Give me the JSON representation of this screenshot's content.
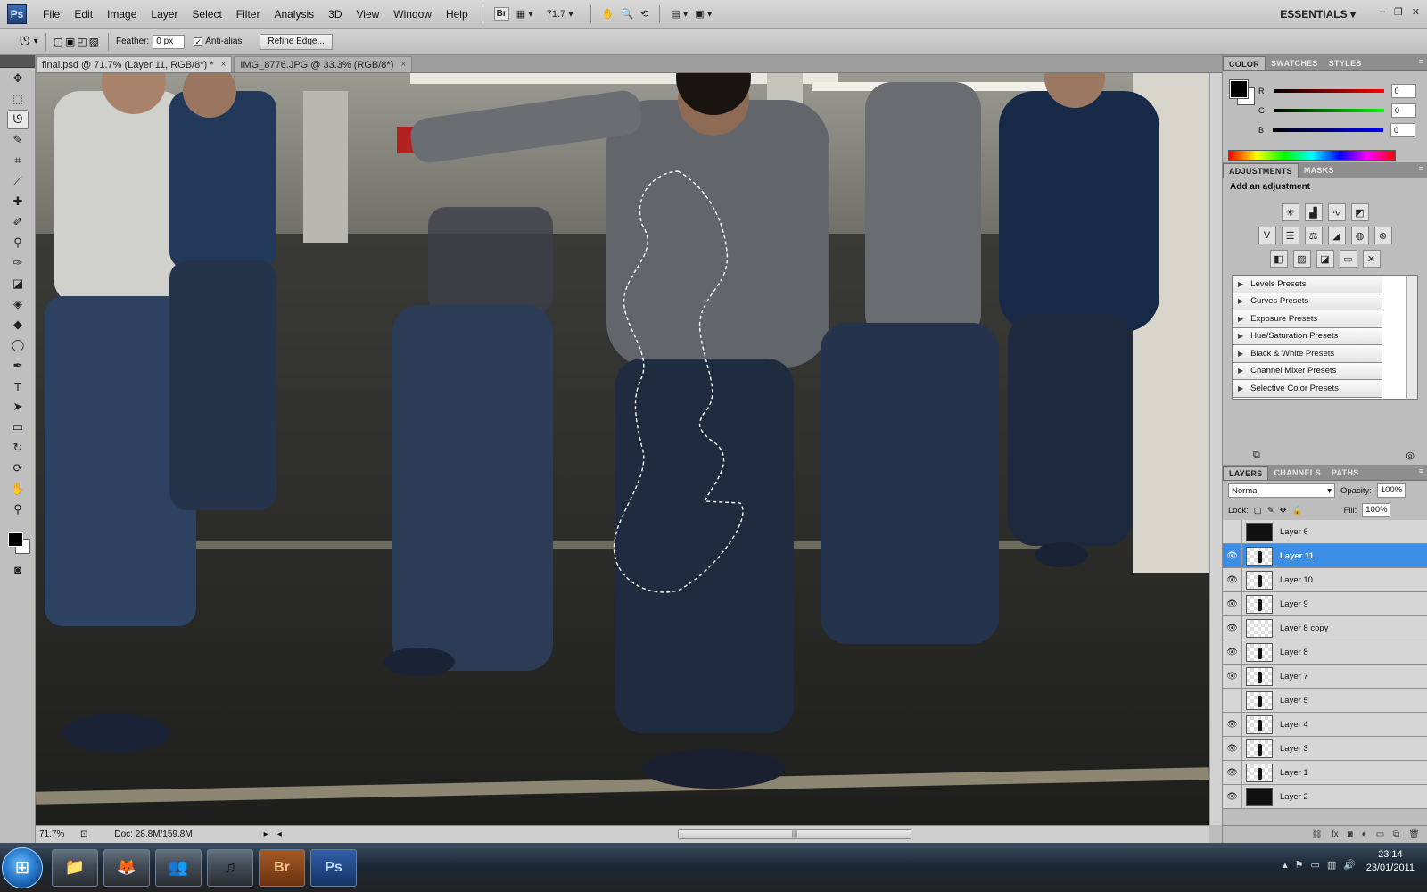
{
  "menubar": {
    "logo": "Ps",
    "items": [
      "File",
      "Edit",
      "Image",
      "Layer",
      "Select",
      "Filter",
      "Analysis",
      "3D",
      "View",
      "Window",
      "Help"
    ],
    "bridge_btn": "Br",
    "zoom": "71.7",
    "workspace": "ESSENTIALS"
  },
  "options": {
    "feather_label": "Feather:",
    "feather_value": "0 px",
    "antialias_label": "Anti-alias",
    "antialias_checked": "✓",
    "refine_edge": "Refine Edge..."
  },
  "tabs": [
    {
      "label": "final.psd @ 71.7% (Layer 11, RGB/8*) *",
      "close": "×"
    },
    {
      "label": "IMG_8776.JPG @ 33.3% (RGB/8*)",
      "close": "×"
    }
  ],
  "status": {
    "zoom": "71.7%",
    "doc": "Doc: 28.8M/159.8M"
  },
  "color_panel": {
    "tabs": [
      "COLOR",
      "SWATCHES",
      "STYLES"
    ],
    "channels": [
      {
        "label": "R",
        "value": "0",
        "color": "#d60000"
      },
      {
        "label": "G",
        "value": "0",
        "color": "#00b000"
      },
      {
        "label": "B",
        "value": "0",
        "color": "#0030d0"
      }
    ]
  },
  "adjustments": {
    "tabs": [
      "ADJUSTMENTS",
      "MASKS"
    ],
    "title": "Add an adjustment",
    "presets": [
      "Levels Presets",
      "Curves Presets",
      "Exposure Presets",
      "Hue/Saturation Presets",
      "Black & White Presets",
      "Channel Mixer Presets",
      "Selective Color Presets"
    ]
  },
  "layers_panel": {
    "tabs": [
      "LAYERS",
      "CHANNELS",
      "PATHS"
    ],
    "blend_mode": "Normal",
    "opacity_label": "Opacity:",
    "opacity": "100%",
    "lock_label": "Lock:",
    "fill_label": "Fill:",
    "fill": "100%",
    "layers": [
      {
        "name": "Layer 6",
        "visible": "",
        "selected": false
      },
      {
        "name": "Layer 11",
        "visible": "👁",
        "selected": true
      },
      {
        "name": "Layer 10",
        "visible": "👁",
        "selected": false
      },
      {
        "name": "Layer 9",
        "visible": "👁",
        "selected": false
      },
      {
        "name": "Layer 8 copy",
        "visible": "👁",
        "selected": false
      },
      {
        "name": "Layer 8",
        "visible": "👁",
        "selected": false
      },
      {
        "name": "Layer 7",
        "visible": "👁",
        "selected": false
      },
      {
        "name": "Layer 5",
        "visible": "",
        "selected": false
      },
      {
        "name": "Layer 4",
        "visible": "👁",
        "selected": false
      },
      {
        "name": "Layer 3",
        "visible": "👁",
        "selected": false
      },
      {
        "name": "Layer 1",
        "visible": "👁",
        "selected": false
      },
      {
        "name": "Layer 2",
        "visible": "👁",
        "selected": false
      }
    ]
  },
  "taskbar": {
    "apps": [
      "explorer-icon",
      "firefox-icon",
      "messenger-icon",
      "itunes-icon",
      "bridge-icon",
      "photoshop-icon"
    ],
    "bridge_label": "Br",
    "ps_label": "Ps",
    "time": "23:14",
    "date": "23/01/2011"
  }
}
